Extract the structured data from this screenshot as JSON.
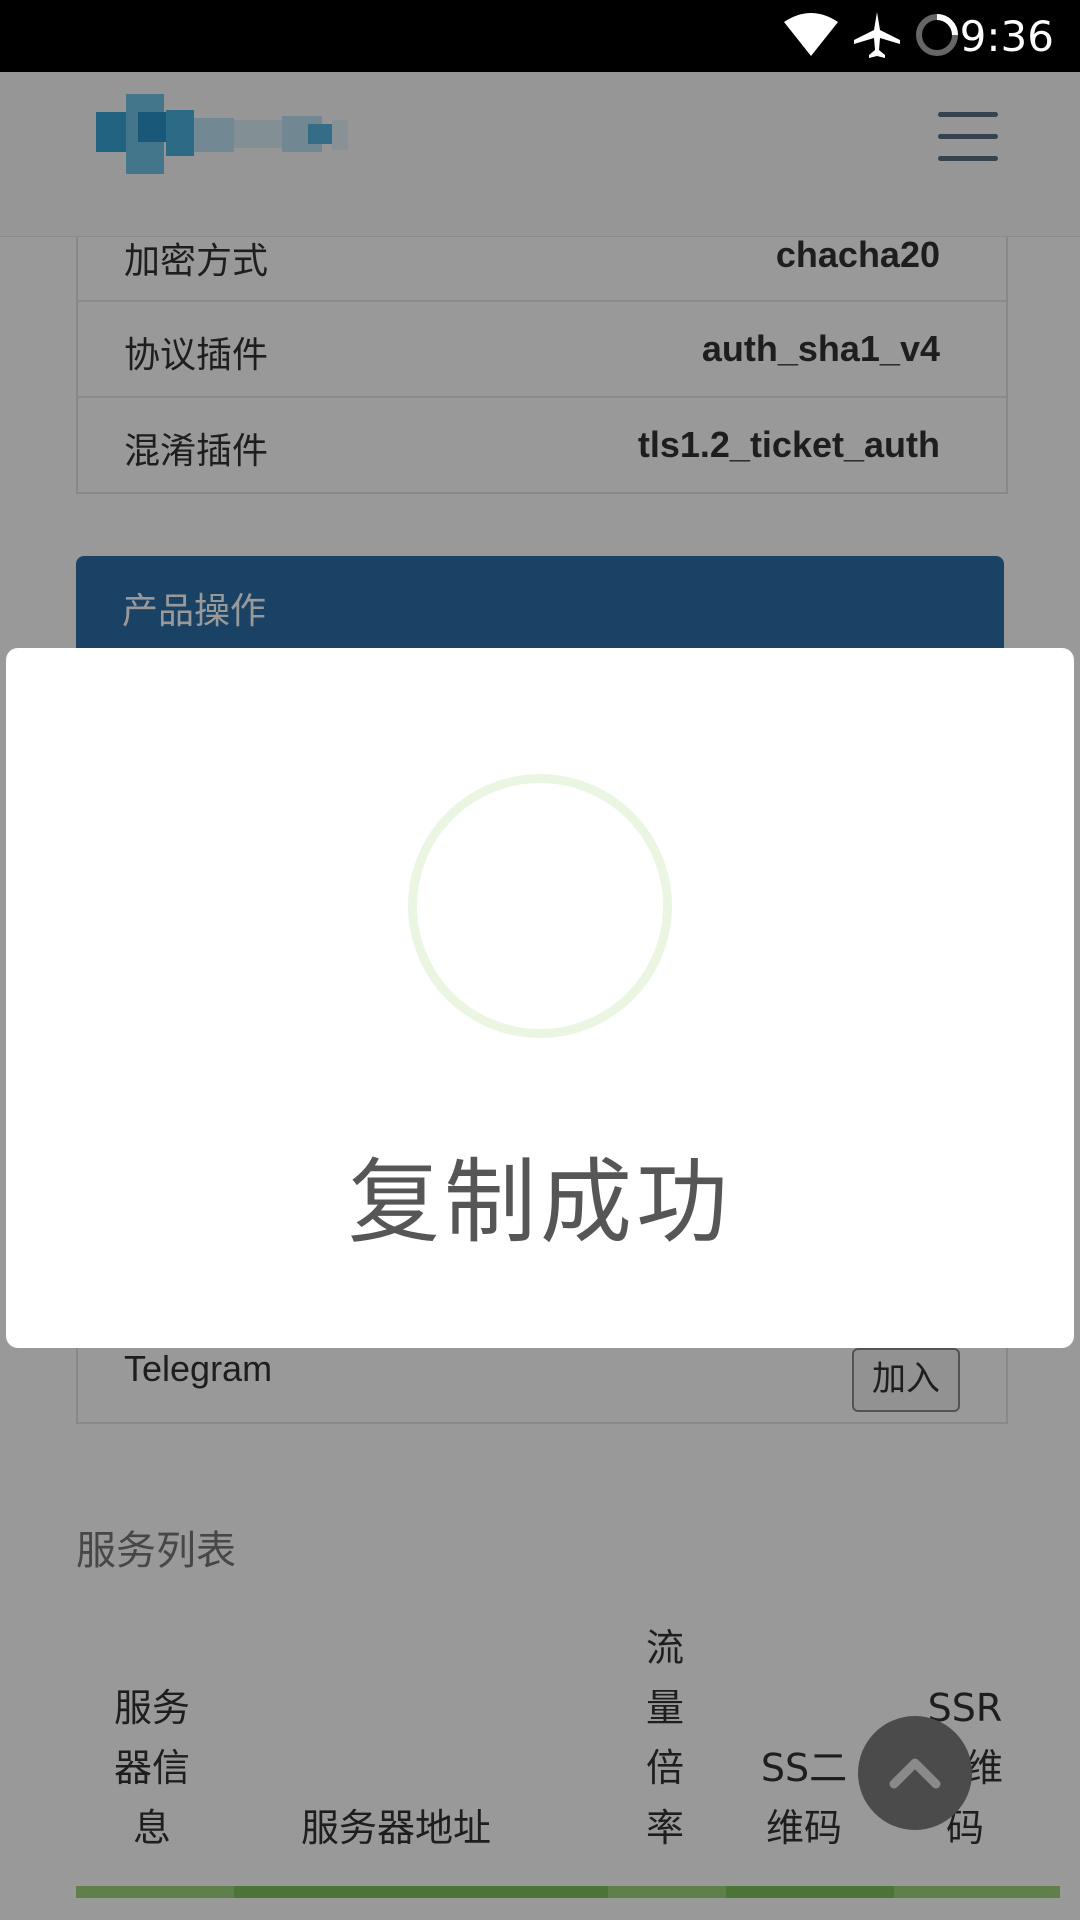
{
  "status_bar": {
    "time": "9:36"
  },
  "info_rows": [
    {
      "key": "加密方式",
      "value": "chacha20"
    },
    {
      "key": "协议插件",
      "value": "auth_sha1_v4"
    },
    {
      "key": "混淆插件",
      "value": "tls1.2_ticket_auth"
    }
  ],
  "panel": {
    "title": "产品操作"
  },
  "telegram_row": {
    "label": "Telegram",
    "button": "加入"
  },
  "services": {
    "title": "服务列表",
    "columns": [
      "服务器信息",
      "服务器地址",
      "流量倍率",
      "SS二维码",
      "SSR二维码"
    ]
  },
  "modal": {
    "message": "复制成功"
  },
  "colors": {
    "panel_blue": "#2b6fa8",
    "accent_green": "#7dc15a"
  }
}
